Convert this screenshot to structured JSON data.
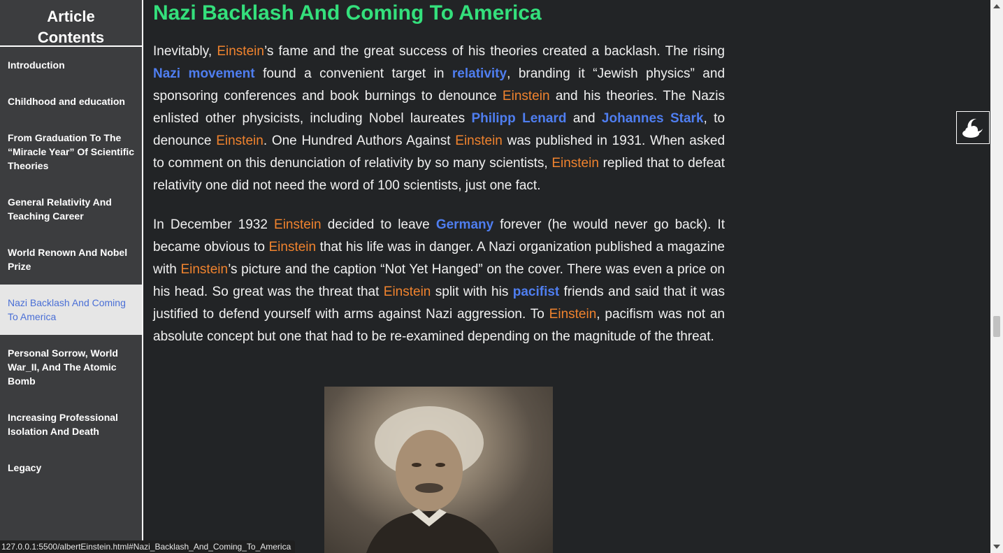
{
  "sidebar": {
    "title_line1": "Article",
    "title_line2": "Contents",
    "items": [
      {
        "label": "Introduction"
      },
      {
        "label": "Childhood and education"
      },
      {
        "label": "From Graduation To The “Miracle Year” Of Scientific Theories"
      },
      {
        "label": "General Relativity And Teaching Career"
      },
      {
        "label": "World Renown And Nobel Prize"
      },
      {
        "label": "Nazi Backlash And Coming To America"
      },
      {
        "label": "Personal Sorrow, World War_II, And The Atomic Bomb"
      },
      {
        "label": "Increasing Professional Isolation And Death"
      },
      {
        "label": "Legacy"
      }
    ],
    "active_index": 5
  },
  "article": {
    "heading": "Nazi Backlash And Coming To America",
    "paragraph1": [
      {
        "text": "Inevitably, ",
        "style": "plain"
      },
      {
        "text": "Einstein",
        "style": "orange"
      },
      {
        "text": "’s fame and the great success of his theories created a backlash. The rising ",
        "style": "plain"
      },
      {
        "text": "Nazi movement",
        "style": "blue"
      },
      {
        "text": " found a convenient target in ",
        "style": "plain"
      },
      {
        "text": "relativity",
        "style": "blue"
      },
      {
        "text": ", branding it “Jewish physics” and sponsoring conferences and book burnings to denounce ",
        "style": "plain"
      },
      {
        "text": "Einstein",
        "style": "orange"
      },
      {
        "text": " and his theories. The Nazis enlisted other physicists, including Nobel laureates ",
        "style": "plain"
      },
      {
        "text": "Philipp Lenard",
        "style": "blue"
      },
      {
        "text": " and ",
        "style": "plain"
      },
      {
        "text": "Johannes Stark",
        "style": "blue"
      },
      {
        "text": ", to denounce ",
        "style": "plain"
      },
      {
        "text": "Einstein",
        "style": "orange"
      },
      {
        "text": ". One Hundred Authors Against ",
        "style": "plain"
      },
      {
        "text": "Einstein",
        "style": "orange"
      },
      {
        "text": " was published in 1931. When asked to comment on this denunciation of relativity by so many scientists, ",
        "style": "plain"
      },
      {
        "text": "Einstein",
        "style": "orange"
      },
      {
        "text": " replied that to defeat relativity one did not need the word of 100 scientists, just one fact.",
        "style": "plain"
      }
    ],
    "paragraph2": [
      {
        "text": "In December 1932 ",
        "style": "plain"
      },
      {
        "text": "Einstein",
        "style": "orange"
      },
      {
        "text": " decided to leave ",
        "style": "plain"
      },
      {
        "text": "Germany",
        "style": "blue"
      },
      {
        "text": " forever (he would never go back). It became obvious to ",
        "style": "plain"
      },
      {
        "text": "Einstein",
        "style": "orange"
      },
      {
        "text": " that his life was in danger. A Nazi organization published a magazine with ",
        "style": "plain"
      },
      {
        "text": "Einstein",
        "style": "orange"
      },
      {
        "text": "’s picture and the caption “Not Yet Hanged” on the cover. There was even a price on his head. So great was the threat that ",
        "style": "plain"
      },
      {
        "text": "Einstein",
        "style": "orange"
      },
      {
        "text": " split with his ",
        "style": "plain"
      },
      {
        "text": "pacifist",
        "style": "blue"
      },
      {
        "text": " friends and said that it was justified to defend yourself with arms against Nazi aggression. To ",
        "style": "plain"
      },
      {
        "text": "Einstein",
        "style": "orange"
      },
      {
        "text": ", pacifism was not an absolute concept but one that had to be re-examined depending on the magnitude of the threat.",
        "style": "plain"
      }
    ]
  },
  "theme_toggle": {
    "icon": "moon-cloud-icon"
  },
  "status_bar": {
    "url": "127.0.0.1:5500/albertEinstein.html#Nazi_Backlash_And_Coming_To_America"
  },
  "colors": {
    "background": "#222426",
    "sidebar": "#3c3d3f",
    "heading": "#34e07c",
    "name_highlight": "#f0832e",
    "link": "#4f7ef0",
    "active_item_bg": "#e6e6e6"
  }
}
